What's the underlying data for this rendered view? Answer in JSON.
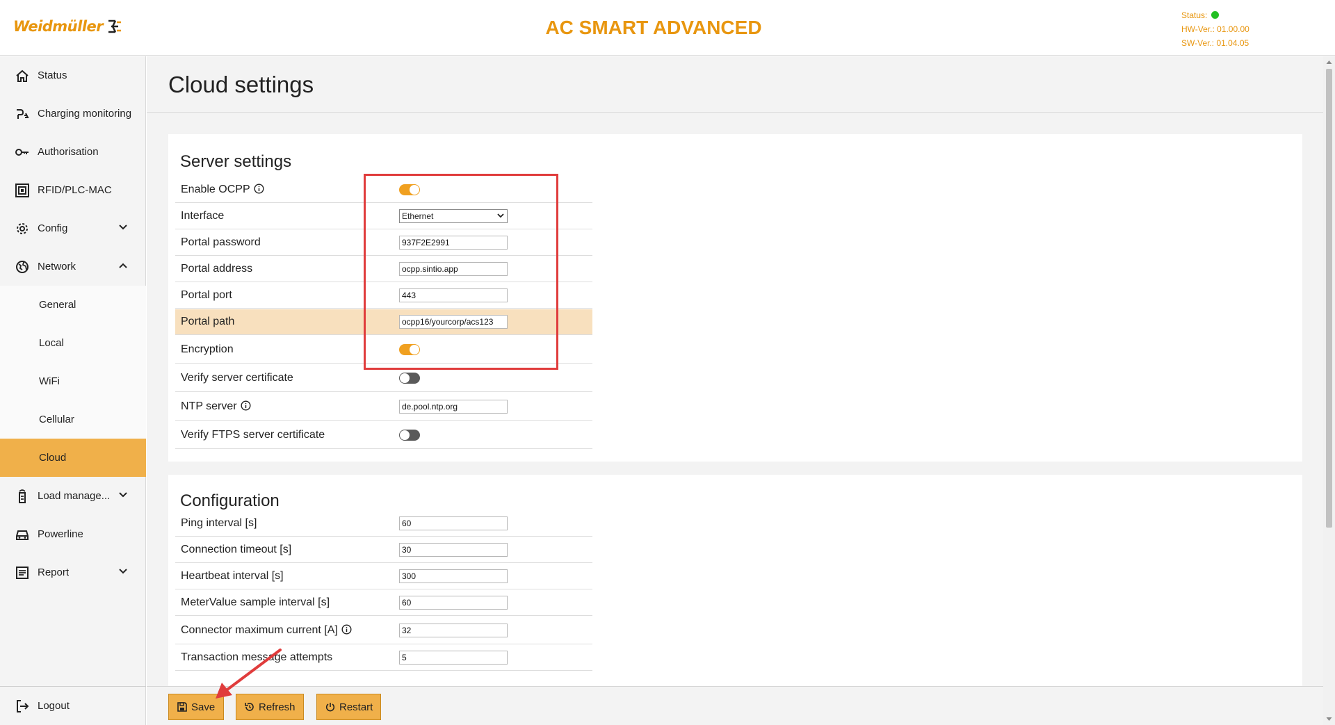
{
  "header": {
    "brand": "Weidmüller",
    "title": "AC SMART ADVANCED",
    "status_label": "Status:",
    "status_color": "#22c022",
    "hw_version": "HW-Ver.: 01.00.00",
    "sw_version": "SW-Ver.: 01.04.05",
    "accent_color": "#e8960f"
  },
  "sidebar": {
    "items": [
      {
        "label": "Status",
        "icon": "home-icon"
      },
      {
        "label": "Charging monitoring",
        "icon": "charging-icon"
      },
      {
        "label": "Authorisation",
        "icon": "key-icon"
      },
      {
        "label": "RFID/PLC-MAC",
        "icon": "rfid-icon"
      },
      {
        "label": "Config",
        "icon": "gear-icon"
      },
      {
        "label": "Network",
        "icon": "globe-icon"
      },
      {
        "label": "Load manage...",
        "icon": "load-management-icon"
      },
      {
        "label": "Powerline",
        "icon": "car-icon"
      },
      {
        "label": "Report",
        "icon": "report-icon"
      }
    ],
    "network_sub": [
      "General",
      "Local",
      "WiFi",
      "Cellular",
      "Cloud"
    ],
    "active_sub": "Cloud",
    "logout": "Logout"
  },
  "main": {
    "page_title": "Cloud settings",
    "server": {
      "title": "Server settings",
      "enable_ocpp": {
        "label": "Enable OCPP",
        "on": true
      },
      "interface": {
        "label": "Interface",
        "value": "Ethernet"
      },
      "portal_password": {
        "label": "Portal password",
        "value": "937F2E2991"
      },
      "portal_address": {
        "label": "Portal address",
        "value": "ocpp.sintio.app"
      },
      "portal_port": {
        "label": "Portal port",
        "value": "443"
      },
      "portal_path": {
        "label": "Portal path",
        "value": "ocpp16/yourcorp/acs123"
      },
      "encryption": {
        "label": "Encryption",
        "on": true
      },
      "verify_server_cert": {
        "label": "Verify server certificate",
        "on": false
      },
      "ntp_server": {
        "label": "NTP server",
        "value": "de.pool.ntp.org"
      },
      "verify_ftps_cert": {
        "label": "Verify FTPS server certificate",
        "on": false
      }
    },
    "configuration": {
      "title": "Configuration",
      "ping_interval": {
        "label": "Ping interval [s]",
        "value": "60"
      },
      "connection_timeout": {
        "label": "Connection timeout [s]",
        "value": "30"
      },
      "heartbeat_interval": {
        "label": "Heartbeat interval [s]",
        "value": "300"
      },
      "metervalue_interval": {
        "label": "MeterValue sample interval [s]",
        "value": "60"
      },
      "connector_max_current": {
        "label": "Connector maximum current [A]",
        "value": "32"
      },
      "transaction_attempts": {
        "label": "Transaction message attempts",
        "value": "5"
      }
    }
  },
  "buttons": {
    "save": "Save",
    "refresh": "Refresh",
    "restart": "Restart"
  }
}
